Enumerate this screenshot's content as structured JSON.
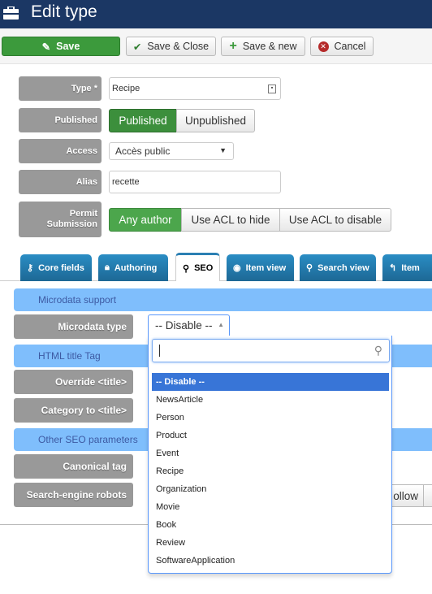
{
  "header": {
    "title": "Edit type",
    "icon": "briefcase-icon"
  },
  "toolbar": {
    "save": "Save",
    "save_close": "Save & Close",
    "save_new": "Save & new",
    "cancel": "Cancel"
  },
  "form": {
    "type_label": "Type *",
    "type_value": "Recipe",
    "published_label": "Published",
    "published_options": [
      "Published",
      "Unpublished"
    ],
    "published_selected": "Published",
    "access_label": "Access",
    "access_value": "Accès public",
    "alias_label": "Alias",
    "alias_value": "recette",
    "permit_label_1": "Permit",
    "permit_label_2": "Submission",
    "permit_options": [
      "Any author",
      "Use ACL to hide",
      "Use ACL to disable"
    ],
    "permit_selected": "Any author"
  },
  "tabs": [
    {
      "label": "Core fields",
      "icon": "key-icon"
    },
    {
      "label": "Authoring",
      "icon": "lock-icon"
    },
    {
      "label": "SEO",
      "icon": "search-icon",
      "active": true
    },
    {
      "label": "Item view",
      "icon": "eye-icon"
    },
    {
      "label": "Search view",
      "icon": "search-icon"
    },
    {
      "label": "Item",
      "icon": "reply-icon"
    }
  ],
  "seo": {
    "microdata_section": "Microdata support",
    "microdata_type_label": "Microdata type",
    "microdata_type_value": "-- Disable --",
    "html_title_section": "HTML title Tag",
    "override_label": "Override <title>",
    "category_label": "Category to <title>",
    "other_section": "Other SEO parameters",
    "canonical_label": "Canonical tag",
    "robots_label": "Search-engine robots",
    "robots_partial_button": "ollow"
  },
  "dropdown": {
    "search_value": "",
    "options": [
      "-- Disable --",
      "NewsArticle",
      "Person",
      "Product",
      "Event",
      "Recipe",
      "Organization",
      "Movie",
      "Book",
      "Review",
      "SoftwareApplication"
    ],
    "highlighted": "-- Disable --"
  },
  "colors": {
    "header": "#1b3764",
    "green": "#3c9a3c",
    "section": "#7fbefc",
    "highlight": "#3875d7",
    "tab": "#2a8dc4"
  }
}
